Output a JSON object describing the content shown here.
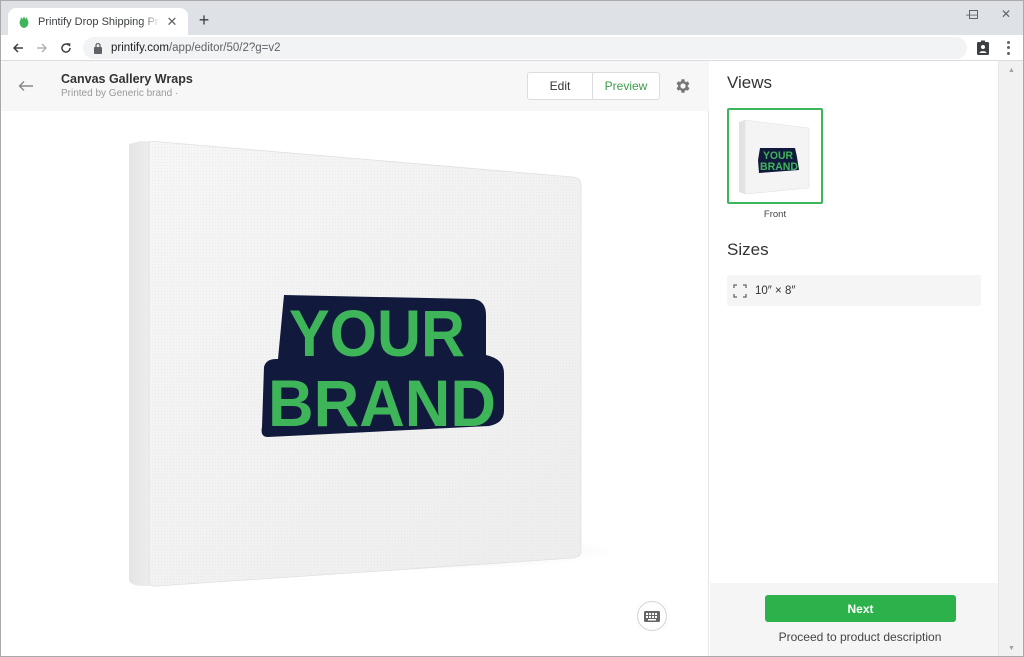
{
  "browser": {
    "tab_title": "Printify Drop Shipping Print on Demand",
    "tab_close": "✕",
    "new_tab": "+",
    "url_host": "printify.com",
    "url_path": "/app/editor/50/2?g=v2",
    "window_controls": {
      "minimize": "—",
      "maximize": "☐",
      "close": "✕"
    }
  },
  "editor": {
    "product_title": "Canvas Gallery Wraps",
    "product_subtitle": "Printed by Generic brand ·",
    "mode_buttons": {
      "edit": "Edit",
      "preview": "Preview"
    },
    "active_mode": "preview",
    "design_text": {
      "line1": "YOUR",
      "line2": "BRAND"
    }
  },
  "sidebar": {
    "views_title": "Views",
    "views": [
      {
        "label": "Front",
        "selected": true
      }
    ],
    "sizes_title": "Sizes",
    "sizes": [
      {
        "label": "10″ × 8″"
      }
    ],
    "next_button": "Next",
    "next_hint": "Proceed to product description"
  },
  "colors": {
    "accent_green": "#2db14b",
    "design_green": "#3fb55a",
    "design_navy": "#111a3d"
  }
}
